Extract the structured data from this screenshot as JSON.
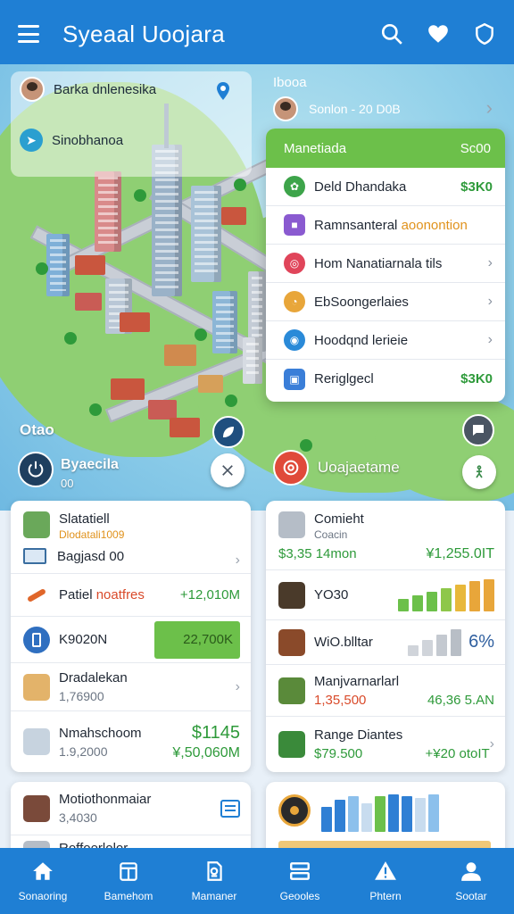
{
  "header": {
    "title": "Syeaal Uoojara"
  },
  "map": {
    "location_name": "Barka dnlenesika",
    "sub_location": "Sinobhanoa",
    "overlay_label": "Otao",
    "stat_label": "Byaecila",
    "stat_value": "00",
    "right_label": "Uoajaetame"
  },
  "right_header": {
    "title": "Ibooa",
    "subtitle": "Sonlon - 20 D0B"
  },
  "menu": {
    "head_label": "Manetiada",
    "head_value": "Sc00",
    "items": [
      {
        "label": "Deld Dhandaka",
        "value": "$3K0"
      },
      {
        "label": "Ramnsanteral",
        "accent": "aoonontion"
      },
      {
        "label": "Hom Nanatiarnala tils"
      },
      {
        "label": "EbSoongerlaies"
      },
      {
        "label": "Hoodqnd lerieie"
      },
      {
        "label": "Reriglgecl",
        "value": "$3K0"
      }
    ]
  },
  "left_card": {
    "rows": [
      {
        "title": "Slatatiell",
        "subtitle": "Dlodatali1009",
        "detail": "Bagjasd 00"
      },
      {
        "title": "Patiel",
        "accent": "noatfres",
        "value": "+12,010M"
      },
      {
        "title": "K9020N",
        "value": "22,700K"
      },
      {
        "title": "Dradalekan",
        "subtitle": "1,76900"
      },
      {
        "title": "Nmahschoom",
        "subtitle": "1.9,2000",
        "value1": "$1145",
        "value2": "¥,50,060M"
      }
    ]
  },
  "right_card": {
    "rows": [
      {
        "title": "Comieht",
        "subtitle": "Coacin",
        "v_left": "$3,35 14mon",
        "v_right": "¥1,255.0IT"
      },
      {
        "title": "YO30",
        "bars": [
          22,
          30,
          26,
          34,
          30,
          38,
          36
        ]
      },
      {
        "title": "WiO.blltar",
        "value": "6%"
      },
      {
        "title": "Manjvarnarlarl",
        "v_left": "1,35,500",
        "v_right": "46,36 5.AN"
      },
      {
        "title": "Range Diantes",
        "v_left": "$79.500",
        "v_right": "+¥20 otoIT"
      }
    ]
  },
  "bottom_left": {
    "title": "Motiothonmaiar",
    "subtitle": "3,4030",
    "partial": "Roffoerlolor"
  },
  "bottom_right": {
    "bars": [
      18,
      26,
      30,
      24,
      36,
      38,
      34,
      30,
      36
    ]
  },
  "tabs": [
    {
      "label": "Sonaoring",
      "icon": "home-icon"
    },
    {
      "label": "Bamehom",
      "icon": "store-icon"
    },
    {
      "label": "Mamaner",
      "icon": "document-icon"
    },
    {
      "label": "Geooles",
      "icon": "layers-icon"
    },
    {
      "label": "Phtern",
      "icon": "alert-icon"
    },
    {
      "label": "Sootar",
      "icon": "person-icon"
    }
  ],
  "colors": {
    "primary": "#1f7fd4",
    "green": "#6cc04a",
    "accent_orange": "#e0921c",
    "accent_red": "#d94a2a"
  }
}
